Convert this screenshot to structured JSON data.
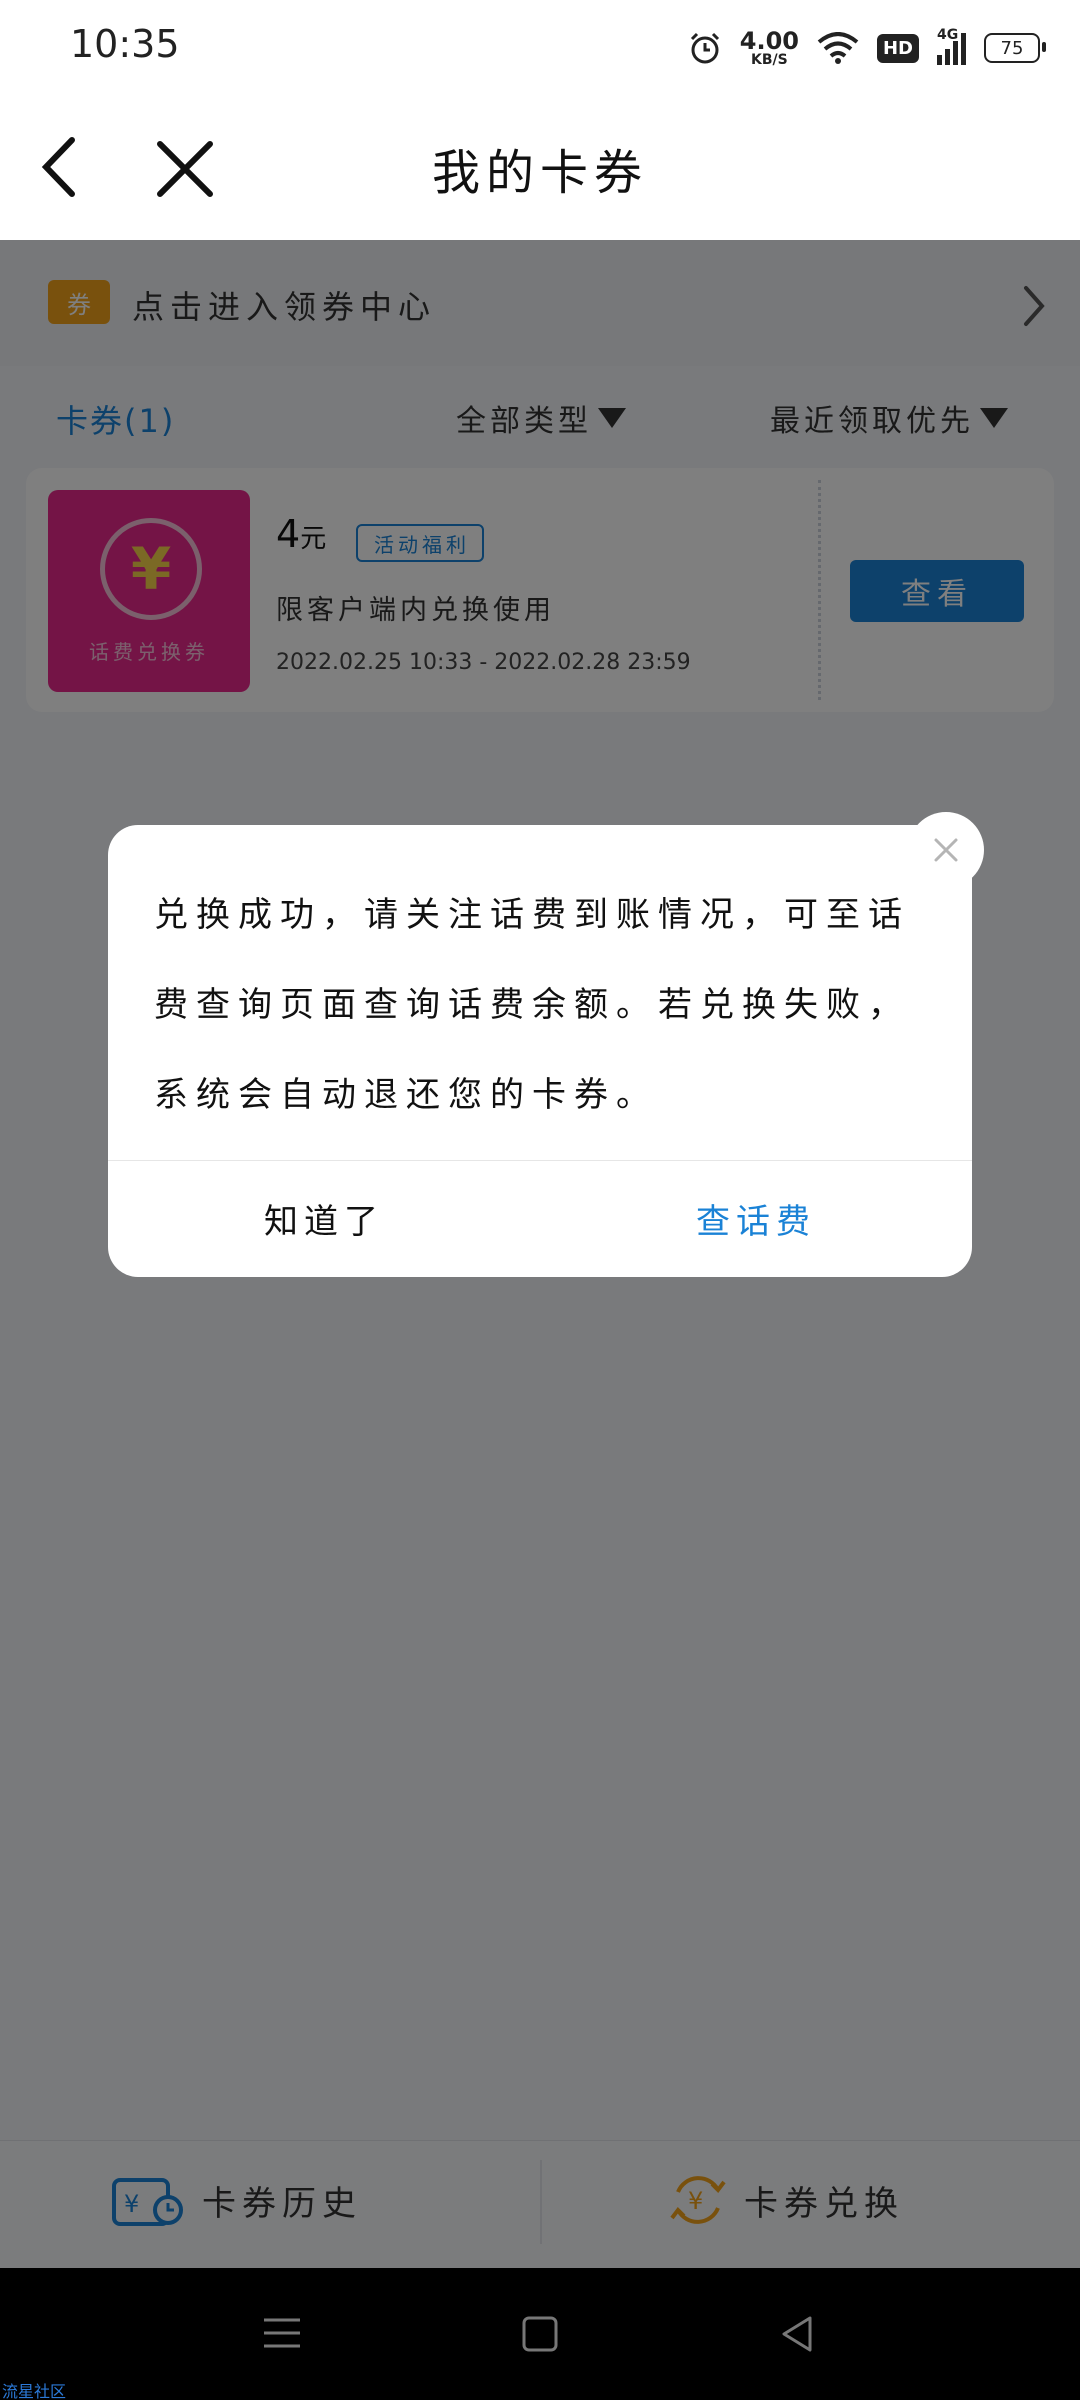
{
  "status": {
    "time": "10:35",
    "speed": "4.00",
    "speed_unit": "KB/S",
    "hd": "HD",
    "network": "4G",
    "battery": "75"
  },
  "header": {
    "title": "我的卡券"
  },
  "coupon_center": {
    "tag": "券",
    "label": "点击进入领券中心"
  },
  "filters": {
    "tab": "卡券(1)",
    "type": "全部类型",
    "sort": "最近领取优先"
  },
  "coupon": {
    "image_label": "话费兑换券",
    "amount": "4",
    "amount_unit": "元",
    "tag": "活动福利",
    "description": "限客户端内兑换使用",
    "validity": "2022.02.25 10:33 - 2022.02.28 23:59",
    "action": "查看"
  },
  "dialog": {
    "message": "兑换成功，请关注话费到账情况，可至话费查询页面查询话费余额。若兑换失败，系统会自动退还您的卡券。",
    "ok_label": "知道了",
    "check_label": "查话费"
  },
  "bottom": {
    "history": "卡券历史",
    "exchange": "卡券兑换"
  },
  "watermark": "流星社区",
  "colors": {
    "accent": "#1a82d6",
    "coupon_bg": "#e8298d",
    "tag_orange": "#f3a31b"
  }
}
